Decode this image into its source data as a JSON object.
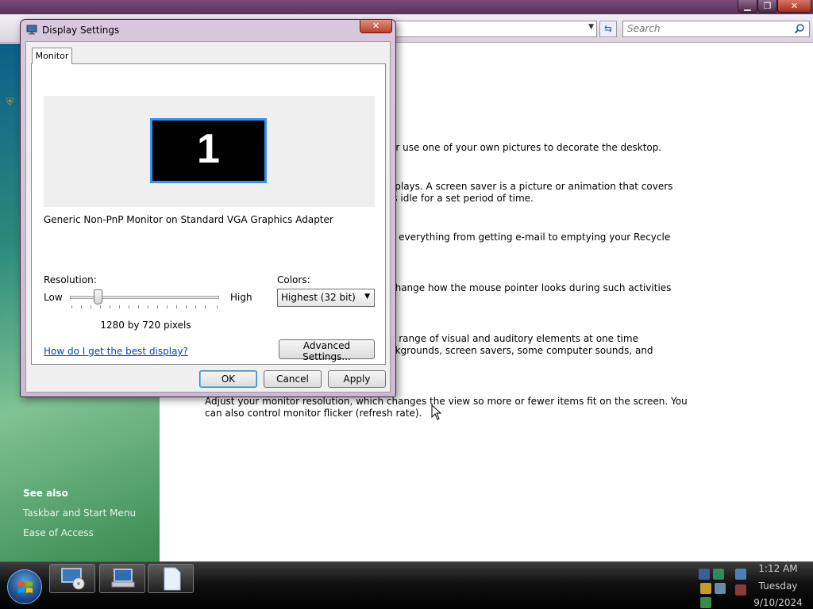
{
  "background_window": {
    "search": {
      "placeholder": "Search"
    },
    "see_also": {
      "title": "See also",
      "links": [
        "Taskbar and Start Menu",
        "Ease of Access"
      ]
    },
    "descriptions": [
      "or use one of your own pictures to decorate the desktop.",
      "splays. A screen saver is a picture or animation that covers",
      "is idle for a set period of time.",
      "o everything from getting e-mail to emptying your Recycle",
      "change how the mouse pointer looks during such activities",
      "e range of visual and auditory elements at one time",
      "ckgrounds, screen savers, some computer sounds, and",
      "Adjust your monitor resolution, which changes the view so more or fewer items fit on the screen. You",
      "can also control monitor flicker (refresh rate)."
    ]
  },
  "dialog": {
    "title": "Display Settings",
    "tab_label": "Monitor",
    "monitor_number": "1",
    "monitor_name": "Generic Non-PnP Monitor on Standard VGA Graphics Adapter",
    "resolution": {
      "label": "Resolution:",
      "low_label": "Low",
      "high_label": "High",
      "value_text": "1280 by 720 pixels"
    },
    "colors": {
      "label": "Colors:",
      "selected": "Highest (32 bit)"
    },
    "help_link": "How do I get the best display?",
    "advanced_button": "Advanced Settings...",
    "ok_button": "OK",
    "cancel_button": "Cancel",
    "apply_button": "Apply"
  },
  "taskbar": {
    "clock": {
      "time": "1:12 AM",
      "day": "Tuesday",
      "date": "9/10/2024"
    }
  }
}
